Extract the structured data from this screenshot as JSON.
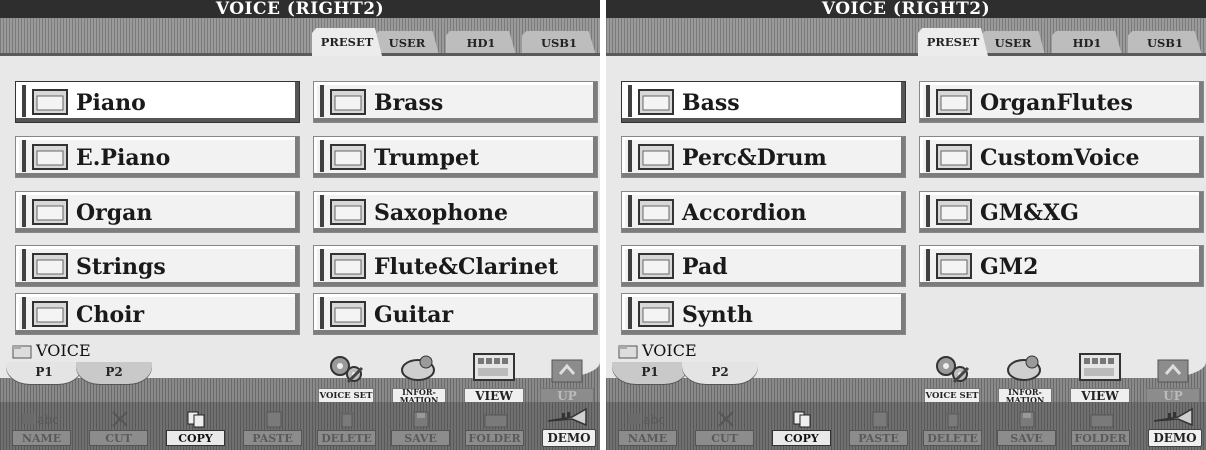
{
  "screens": [
    {
      "title": "VOICE (RIGHT2)",
      "bank_tabs": [
        {
          "label": "PRESET",
          "active": true
        },
        {
          "label": "USER",
          "active": false
        },
        {
          "label": "HD1",
          "active": false
        },
        {
          "label": "USB1",
          "active": false
        }
      ],
      "folders": [
        {
          "label": "Piano",
          "icon": "folder-icon",
          "selected": true
        },
        {
          "label": "Brass",
          "icon": "folder-icon",
          "selected": false
        },
        {
          "label": "E.Piano",
          "icon": "folder-icon",
          "selected": false
        },
        {
          "label": "Trumpet",
          "icon": "folder-icon",
          "selected": false
        },
        {
          "label": "Organ",
          "icon": "folder-icon",
          "selected": false
        },
        {
          "label": "Saxophone",
          "icon": "folder-icon",
          "selected": false
        },
        {
          "label": "Strings",
          "icon": "folder-icon",
          "selected": false
        },
        {
          "label": "Flute&Clarinet",
          "icon": "folder-icon",
          "selected": false
        },
        {
          "label": "Choir",
          "icon": "folder-icon",
          "selected": false
        },
        {
          "label": "Guitar",
          "icon": "folder-icon",
          "selected": false
        }
      ],
      "path": "VOICE",
      "pages": [
        {
          "label": "P1",
          "active": true
        },
        {
          "label": "P2",
          "active": false
        }
      ],
      "tools": {
        "voice_set": "VOICE SET",
        "information_1": "INFOR-",
        "information_2": "MATION",
        "view": "VIEW",
        "up": "UP"
      },
      "functions": [
        {
          "label": "NAME",
          "enabled": false,
          "icon": "rename-icon",
          "icon_text": "abc"
        },
        {
          "label": "CUT",
          "enabled": false,
          "icon": "scissors-icon"
        },
        {
          "label": "COPY",
          "enabled": true,
          "icon": "copy-icon"
        },
        {
          "label": "PASTE",
          "enabled": false,
          "icon": "paste-icon"
        },
        {
          "label": "DELETE",
          "enabled": false,
          "icon": "trash-icon"
        },
        {
          "label": "SAVE",
          "enabled": false,
          "icon": "disk-icon"
        },
        {
          "label": "FOLDER",
          "enabled": false,
          "icon": "new-folder-icon"
        }
      ],
      "demo": "DEMO"
    },
    {
      "title": "VOICE (RIGHT2)",
      "bank_tabs": [
        {
          "label": "PRESET",
          "active": true
        },
        {
          "label": "USER",
          "active": false
        },
        {
          "label": "HD1",
          "active": false
        },
        {
          "label": "USB1",
          "active": false
        }
      ],
      "folders": [
        {
          "label": "Bass",
          "icon": "folder-icon",
          "selected": true
        },
        {
          "label": "OrganFlutes",
          "icon": "folder-icon",
          "selected": false
        },
        {
          "label": "Perc&Drum",
          "icon": "folder-icon",
          "selected": false
        },
        {
          "label": "CustomVoice",
          "icon": "folder-icon",
          "selected": false
        },
        {
          "label": "Accordion",
          "icon": "folder-icon",
          "selected": false
        },
        {
          "label": "GM&XG",
          "icon": "folder-icon",
          "selected": false
        },
        {
          "label": "Pad",
          "icon": "folder-icon",
          "selected": false
        },
        {
          "label": "GM2",
          "icon": "folder-icon",
          "selected": false
        },
        {
          "label": "Synth",
          "icon": "folder-icon",
          "selected": false
        }
      ],
      "path": "VOICE",
      "pages": [
        {
          "label": "P1",
          "active": false
        },
        {
          "label": "P2",
          "active": true
        }
      ],
      "tools": {
        "voice_set": "VOICE SET",
        "information_1": "INFOR-",
        "information_2": "MATION",
        "view": "VIEW",
        "up": "UP"
      },
      "functions": [
        {
          "label": "NAME",
          "enabled": false,
          "icon": "rename-icon",
          "icon_text": "abc"
        },
        {
          "label": "CUT",
          "enabled": false,
          "icon": "scissors-icon"
        },
        {
          "label": "COPY",
          "enabled": true,
          "icon": "copy-icon"
        },
        {
          "label": "PASTE",
          "enabled": false,
          "icon": "paste-icon"
        },
        {
          "label": "DELETE",
          "enabled": false,
          "icon": "trash-icon"
        },
        {
          "label": "SAVE",
          "enabled": false,
          "icon": "disk-icon"
        },
        {
          "label": "FOLDER",
          "enabled": false,
          "icon": "new-folder-icon"
        }
      ],
      "demo": "DEMO"
    }
  ]
}
